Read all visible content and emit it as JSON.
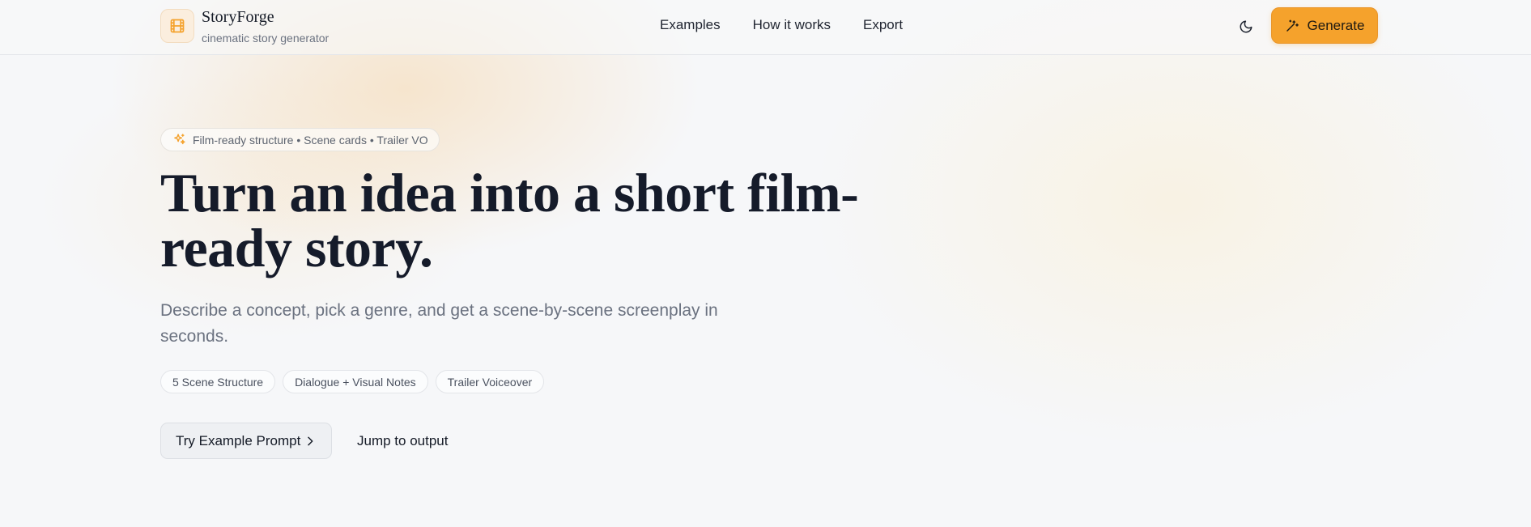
{
  "brand": {
    "name": "StoryForge",
    "tagline": "cinematic story generator",
    "logo_icon": "film-icon"
  },
  "nav": {
    "items": [
      "Examples",
      "How it works",
      "Export"
    ]
  },
  "header": {
    "theme_icon": "moon-icon",
    "generate_label": "Generate",
    "generate_icon": "magic-wand-icon"
  },
  "hero": {
    "badge_icon": "sparkles-icon",
    "badge_text": "Film-ready structure • Scene cards • Trailer VO",
    "headline": "Turn an idea into a short film-ready story.",
    "subtitle": "Describe a concept, pick a genre, and get a scene-by-scene screenplay in seconds.",
    "chips": [
      "5 Scene Structure",
      "Dialogue + Visual Notes",
      "Trailer Voiceover"
    ],
    "primary_action": "Try Example Prompt",
    "secondary_action": "Jump to output"
  },
  "colors": {
    "accent": "#f5a22c",
    "text": "#141a26",
    "muted": "#6b7280",
    "background": "#f6f7f9"
  }
}
